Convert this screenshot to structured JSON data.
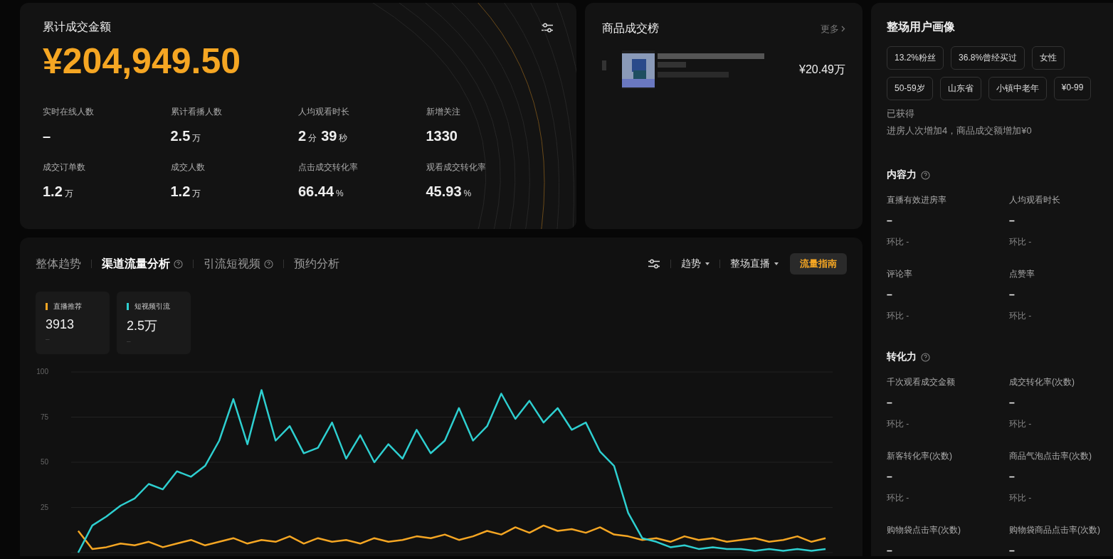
{
  "summary": {
    "title": "累计成交金额",
    "total": "¥204,949.50",
    "metrics": [
      {
        "label": "实时在线人数",
        "value": [
          {
            "text": "–",
            "kind": "number"
          }
        ]
      },
      {
        "label": "累计看播人数",
        "value": [
          {
            "text": "2.5",
            "kind": "number"
          },
          {
            "text": "万",
            "kind": "unit"
          }
        ]
      },
      {
        "label": "人均观看时长",
        "value": [
          {
            "text": "2",
            "kind": "number"
          },
          {
            "text": "分",
            "kind": "unit"
          },
          {
            "text": "39",
            "kind": "number"
          },
          {
            "text": "秒",
            "kind": "unit"
          }
        ]
      },
      {
        "label": "新增关注",
        "value": [
          {
            "text": "1330",
            "kind": "number"
          }
        ]
      },
      {
        "label": "成交订单数",
        "value": [
          {
            "text": "1.2",
            "kind": "number"
          },
          {
            "text": "万",
            "kind": "unit"
          }
        ]
      },
      {
        "label": "成交人数",
        "value": [
          {
            "text": "1.2",
            "kind": "number"
          },
          {
            "text": "万",
            "kind": "unit"
          }
        ]
      },
      {
        "label": "点击成交转化率",
        "value": [
          {
            "text": "66.44",
            "kind": "number"
          },
          {
            "text": "%",
            "kind": "unit"
          }
        ]
      },
      {
        "label": "观看成交转化率",
        "value": [
          {
            "text": "45.93",
            "kind": "number"
          },
          {
            "text": "%",
            "kind": "unit"
          }
        ]
      }
    ]
  },
  "ranking": {
    "title": "商品成交榜",
    "more": "更多",
    "items": [
      {
        "amount": "¥20.49万"
      }
    ]
  },
  "profile": {
    "title": "整场用户画像",
    "tags": [
      "13.2%粉丝",
      "36.8%曾经买过",
      "女性",
      "50-59岁",
      "山东省",
      "小镇中老年",
      "¥0-99"
    ],
    "gained_label": "已获得",
    "gained_text": "进房人次增加4，商品成交额增加¥0",
    "sections": [
      {
        "title": "内容力",
        "metrics": [
          {
            "label": "直播有效进房率",
            "value": "–",
            "compare": "环比 -"
          },
          {
            "label": "人均观看时长",
            "value": "–",
            "compare": "环比 -"
          },
          {
            "label": "评论率",
            "value": "–",
            "compare": "环比 -"
          },
          {
            "label": "点赞率",
            "value": "–",
            "compare": "环比 -"
          }
        ]
      },
      {
        "title": "转化力",
        "metrics": [
          {
            "label": "千次观看成交金额",
            "value": "–",
            "compare": "环比 -"
          },
          {
            "label": "成交转化率(次数)",
            "value": "–",
            "compare": "环比 -"
          },
          {
            "label": "新客转化率(次数)",
            "value": "–",
            "compare": "环比 -"
          },
          {
            "label": "商品气泡点击率(次数)",
            "value": "–",
            "compare": "环比 -"
          },
          {
            "label": "购物袋点击率(次数)",
            "value": "–"
          },
          {
            "label": "购物袋商品点击率(次数)",
            "value": "–"
          }
        ]
      }
    ]
  },
  "traffic": {
    "tabs": [
      {
        "label": "整体趋势",
        "selected": false,
        "help": false
      },
      {
        "label": "渠道流量分析",
        "selected": true,
        "help": true
      },
      {
        "label": "引流短视频",
        "selected": false,
        "help": true
      },
      {
        "label": "预约分析",
        "selected": false,
        "help": false
      }
    ],
    "dropdowns": [
      "趋势",
      "整场直播"
    ],
    "guide_button": "流量指南",
    "channels": [
      {
        "label": "直播推荐",
        "value": "3913",
        "note": "–",
        "color": "#f5a623"
      },
      {
        "label": "短视频引流",
        "value": "2.5万",
        "note": "–",
        "color": "#2ecfd0"
      }
    ],
    "chart_data": {
      "type": "line",
      "grid": true,
      "ylim": [
        0,
        100
      ],
      "yticks": [
        25,
        50,
        75,
        100
      ],
      "series": [
        {
          "color": "#f5a623",
          "values": [
            12,
            2,
            3,
            5,
            4,
            6,
            3,
            5,
            7,
            4,
            6,
            8,
            5,
            7,
            6,
            9,
            5,
            8,
            6,
            7,
            5,
            8,
            6,
            7,
            9,
            8,
            10,
            7,
            9,
            12,
            10,
            14,
            11,
            15,
            12,
            13,
            11,
            14,
            10,
            9,
            7,
            8,
            6,
            9,
            7,
            8,
            6,
            7,
            8,
            6,
            7,
            9,
            6,
            8
          ]
        },
        {
          "color": "#2ecfd0",
          "values": [
            0,
            15,
            20,
            26,
            30,
            38,
            35,
            45,
            42,
            48,
            62,
            85,
            60,
            90,
            62,
            70,
            55,
            58,
            72,
            52,
            65,
            50,
            60,
            52,
            68,
            55,
            62,
            80,
            62,
            70,
            88,
            74,
            84,
            72,
            80,
            68,
            72,
            56,
            48,
            22,
            8,
            6,
            3,
            4,
            2,
            3,
            2,
            2,
            1,
            2,
            1,
            2,
            1,
            2
          ]
        }
      ]
    }
  }
}
